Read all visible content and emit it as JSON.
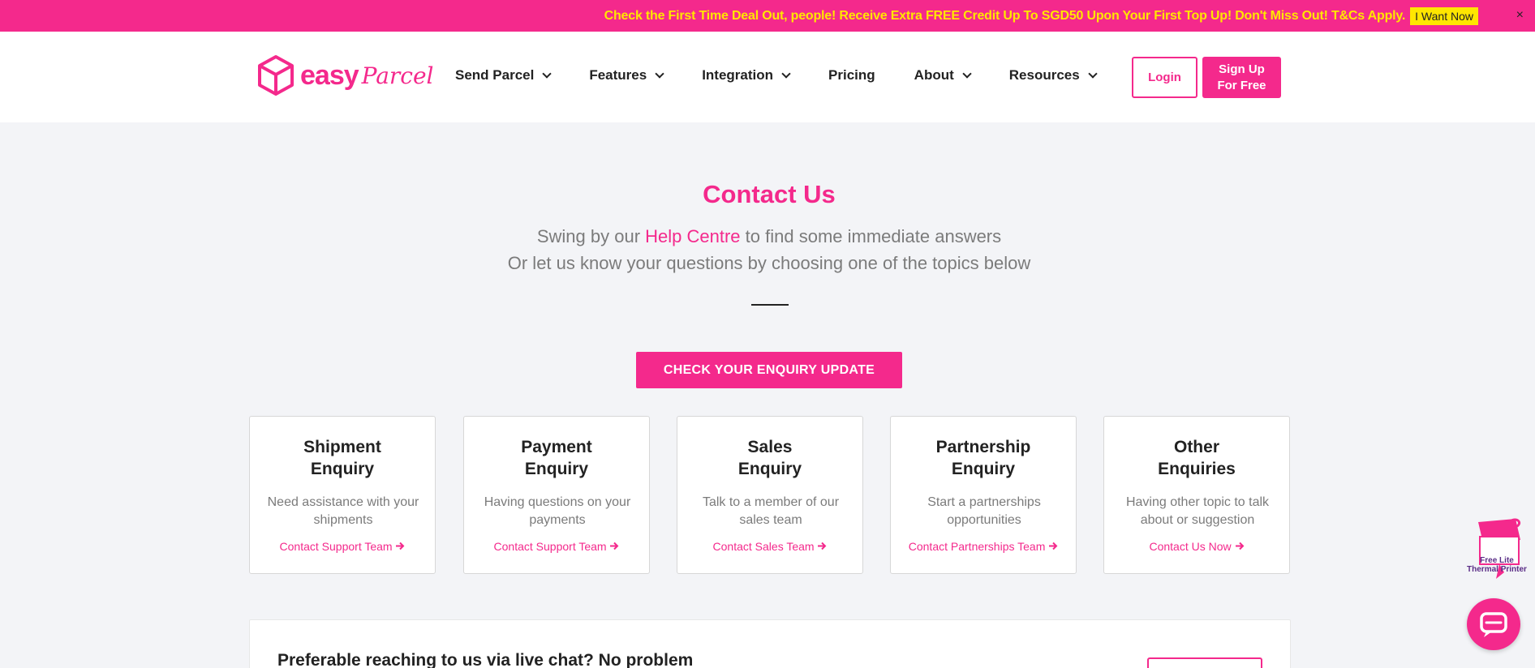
{
  "promo": {
    "text": "Check the First Time Deal Out, people! Receive Extra FREE Credit Up To SGD50 Upon Your First Top Up! Don't Miss Out! T&Cs Apply.",
    "button": "I Want Now",
    "close": "×"
  },
  "header": {
    "logo_word": "easy",
    "logo_script": "Parcel",
    "nav": [
      "Send Parcel",
      "Features",
      "Integration",
      "Pricing",
      "About",
      "Resources"
    ],
    "login": "Login",
    "signup_line1": "Sign Up",
    "signup_line2": "For Free"
  },
  "main": {
    "title": "Contact Us",
    "sub1_before": "Swing by our",
    "sub1_link": "Help Centre",
    "sub1_after": "to find some immediate answers",
    "sub2": "Or let us know your questions by choosing one of the topics below",
    "cta": "CHECK YOUR ENQUIRY UPDATE"
  },
  "cards": [
    {
      "title1": "Shipment",
      "title2": "Enquiry",
      "desc": "Need assistance with your shipments",
      "link": "Contact Support Team"
    },
    {
      "title1": "Payment",
      "title2": "Enquiry",
      "desc": "Having questions on your payments",
      "link": "Contact Support Team"
    },
    {
      "title1": "Sales",
      "title2": "Enquiry",
      "desc": "Talk to a member of our sales team",
      "link": "Contact Sales Team"
    },
    {
      "title1": "Partnership",
      "title2": "Enquiry",
      "desc": "Start a partnerships opportunities",
      "link": "Contact Partnerships Team"
    },
    {
      "title1": "Other",
      "title2": "Enquiries",
      "desc": "Having other topic to talk about or suggestion",
      "link": "Contact Us Now"
    }
  ],
  "livechat": {
    "text": "Preferable reaching to us via live chat? No problem"
  },
  "printer_promo": {
    "line1": "Free Lite",
    "line2": "Thermal Printer"
  },
  "colors": {
    "brand": "#f4298c",
    "promo_text": "#ffe600"
  },
  "icons": {
    "logo": "box-outline-icon",
    "arrow": "arrow-right-icon",
    "chat": "chat-bubble-icon"
  }
}
